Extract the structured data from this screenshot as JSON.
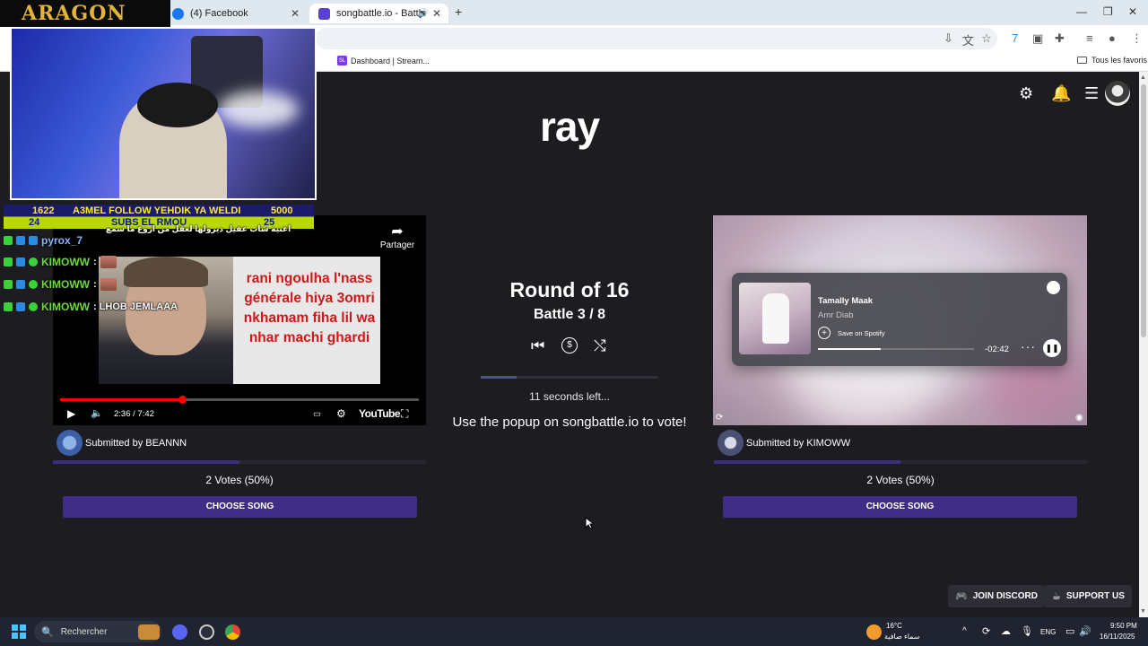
{
  "browser": {
    "tabs": [
      {
        "label": "(4) Facebook",
        "active": false
      },
      {
        "label": "songbattle.io - Battle Song",
        "active": true
      }
    ],
    "new_tab": "+",
    "bookmarks": [
      {
        "label": "Dashboard | Stream..."
      },
      {
        "label": "Tous les favoris"
      }
    ]
  },
  "page": {
    "title": "ray",
    "icons": [
      "gear-icon",
      "bell-icon",
      "menu-icon",
      "avatar"
    ]
  },
  "stream_overlay": {
    "brand": "ARAGON",
    "sub_goal": {
      "row1_left": "1622",
      "row1_center": "A3MEL FOLLOW YEHDIK YA WELDI",
      "row1_right": "5000",
      "row2_left": "24",
      "row2_center": "SUBS EL RMOU",
      "row2_right": "25"
    },
    "chat": [
      {
        "user": "pyrox_7",
        "message": "اغنية شاب عقيل ديرولها لعقل من اروع ما سمع"
      },
      {
        "user": "KIMOWW",
        "message": ":"
      },
      {
        "user": "KIMOWW",
        "message": ":"
      },
      {
        "user": "KIMOWW",
        "message": ": LHOB JEMLAAA"
      }
    ]
  },
  "left_song": {
    "meme_text": "rani ngoulha l'nass générale hiya 3omri nkhamam fiha lil wa nhar machi ghardi",
    "share_label": "Partager",
    "time": "2:36 / 7:42",
    "progress": 0.34,
    "youtube_label": "YouTube",
    "submitted_by": "Submitted by BEANNN",
    "votes": "2 Votes (50%)",
    "vote_share": 0.5,
    "choose_label": "CHOOSE SONG"
  },
  "battle": {
    "round": "Round of 16",
    "battle": "Battle 3 / 8",
    "timer_text": "11 seconds left...",
    "timer_progress": 0.2,
    "vote_hint": "Use the popup on songbattle.io to vote!"
  },
  "right_song": {
    "song_title": "Tamally Maak",
    "artist": "Amr Diab",
    "save_label": "Save on Spotify",
    "remaining": "-02:42",
    "progress": 0.4,
    "submitted_by": "Submitted by KIMOWW",
    "votes": "2 Votes (50%)",
    "vote_share": 0.5,
    "choose_label": "CHOOSE SONG"
  },
  "footer": {
    "discord_label": "JOIN DISCORD",
    "support_label": "SUPPORT US"
  },
  "taskbar": {
    "search_label": "Rechercher",
    "weather_temp": "16°C",
    "weather_desc": "سماء صافية",
    "lang": "ENG",
    "time": "9:50 PM",
    "date": "16/11/2025"
  },
  "colors": {
    "accent": "#3e2c86",
    "page_bg": "#1c1c21",
    "chat_user": "#6bdc3a"
  }
}
